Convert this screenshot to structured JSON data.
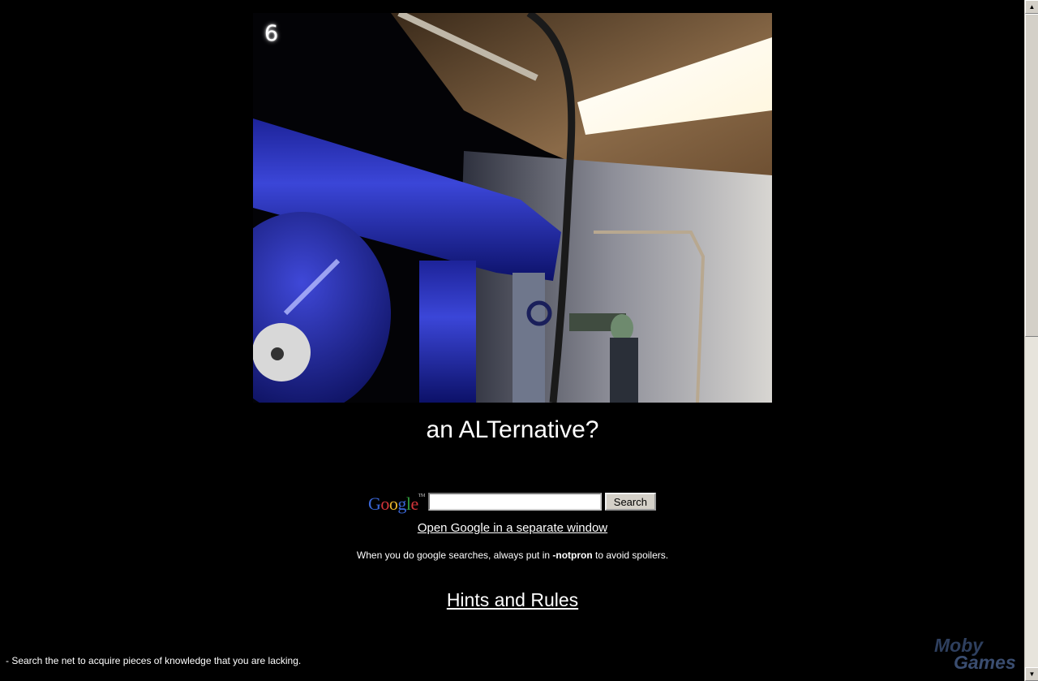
{
  "level": {
    "number": "6",
    "title": "an ALTernative?"
  },
  "search": {
    "logo_letters": [
      "G",
      "o",
      "o",
      "g",
      "l",
      "e"
    ],
    "logo_tm": "TM",
    "input_value": "",
    "button_label": "Search",
    "open_link": "Open Google in a separate window"
  },
  "notice": {
    "before": "When you do google searches, always put in ",
    "keyword": "-notpron",
    "after": " to avoid spoilers."
  },
  "hints_link": "Hints and Rules",
  "footer_tip": "- Search the net to acquire pieces of knowledge that you are lacking.",
  "watermark": {
    "line1": "Moby",
    "line2": "Games"
  },
  "scrollbar": {
    "up_icon": "▲",
    "down_icon": "▼"
  }
}
